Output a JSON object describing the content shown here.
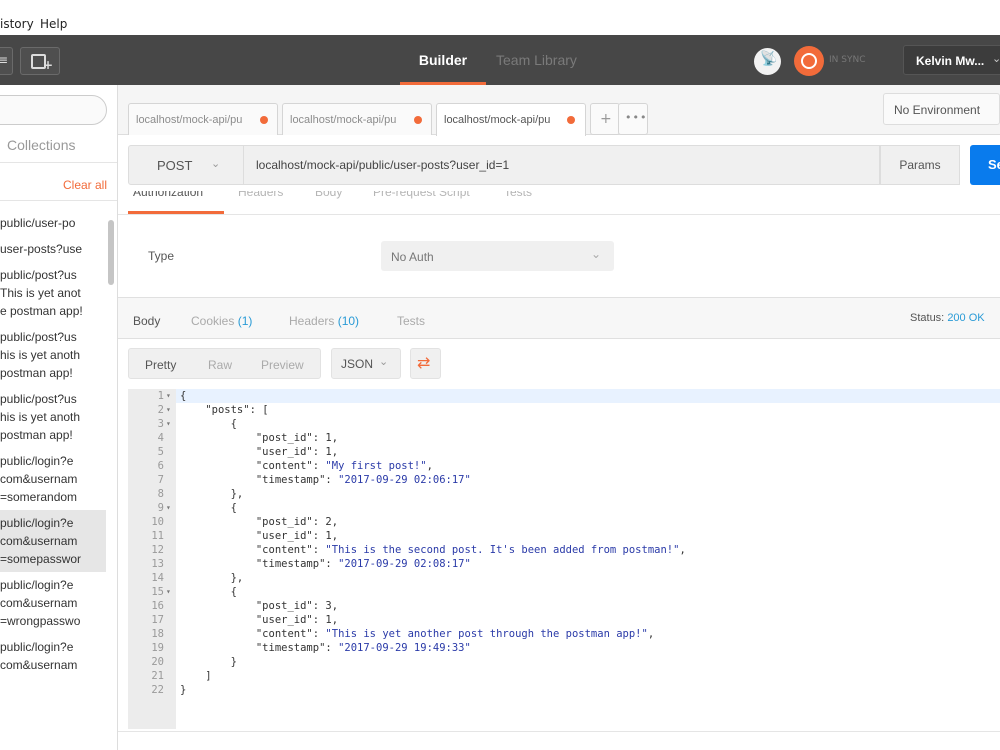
{
  "menubar": {
    "items": [
      {
        "label": "istory"
      },
      {
        "label": "Help"
      }
    ]
  },
  "header": {
    "builder_tab": "Builder",
    "team_tab": "Team Library",
    "sync_status": "IN SYNC",
    "user_name": "Kelvin Mw...",
    "accent_color": "#f26b3a"
  },
  "sidebar": {
    "collections_tab": "Collections",
    "clear_all": "Clear all",
    "history": [
      {
        "lines": [
          "public/user-po"
        ]
      },
      {
        "lines": [
          "user-posts?use"
        ]
      },
      {
        "lines": [
          "public/post?us",
          "This is yet anot",
          "e postman app!"
        ]
      },
      {
        "lines": [
          "public/post?us",
          "his is yet anoth",
          "postman app!"
        ]
      },
      {
        "lines": [
          "public/post?us",
          "his is yet anoth",
          "postman app!"
        ]
      },
      {
        "lines": [
          "public/login?e",
          "com&usernam",
          "=somerandom"
        ]
      },
      {
        "lines": [
          "public/login?e",
          "com&usernam",
          "=somepasswor"
        ],
        "active": true
      },
      {
        "lines": [
          "public/login?e",
          "com&usernam",
          "=wrongpasswo"
        ]
      },
      {
        "lines": [
          "public/login?e",
          "com&usernam"
        ]
      }
    ]
  },
  "request_tabs": [
    {
      "label": "localhost/mock-api/pu"
    },
    {
      "label": "localhost/mock-api/pu"
    },
    {
      "label": "localhost/mock-api/pu"
    }
  ],
  "environment": "No Environment",
  "request": {
    "method": "POST",
    "url": "localhost/mock-api/public/user-posts?user_id=1",
    "params_label": "Params",
    "send_label": "Se"
  },
  "request_section_tabs": {
    "authorization": "Authorization",
    "headers": "Headers",
    "body": "Body",
    "prerequest": "Pre-request Script",
    "tests": "Tests"
  },
  "auth": {
    "type_label": "Type",
    "type_value": "No Auth"
  },
  "response": {
    "tabs": {
      "body": "Body",
      "cookies": "Cookies",
      "cookies_count": "(1)",
      "headers": "Headers",
      "headers_count": "(10)",
      "tests": "Tests"
    },
    "status_label": "Status:",
    "status_value": "200 OK",
    "view_modes": {
      "pretty": "Pretty",
      "raw": "Raw",
      "preview": "Preview"
    },
    "format": "JSON"
  },
  "code_lines": [
    {
      "n": "1",
      "fold": true,
      "text": "{"
    },
    {
      "n": "2",
      "fold": true,
      "text": "    \"posts\": ["
    },
    {
      "n": "3",
      "fold": true,
      "text": "        {"
    },
    {
      "n": "4",
      "text": "            \"post_id\": 1,"
    },
    {
      "n": "5",
      "text": "            \"user_id\": 1,"
    },
    {
      "n": "6",
      "text": "            \"content\": \"My first post!\","
    },
    {
      "n": "7",
      "text": "            \"timestamp\": \"2017-09-29 02:06:17\""
    },
    {
      "n": "8",
      "text": "        },"
    },
    {
      "n": "9",
      "fold": true,
      "text": "        {"
    },
    {
      "n": "10",
      "text": "            \"post_id\": 2,"
    },
    {
      "n": "11",
      "text": "            \"user_id\": 1,"
    },
    {
      "n": "12",
      "text": "            \"content\": \"This is the second post. It's been added from postman!\","
    },
    {
      "n": "13",
      "text": "            \"timestamp\": \"2017-09-29 02:08:17\""
    },
    {
      "n": "14",
      "text": "        },"
    },
    {
      "n": "15",
      "fold": true,
      "text": "        {"
    },
    {
      "n": "16",
      "text": "            \"post_id\": 3,"
    },
    {
      "n": "17",
      "text": "            \"user_id\": 1,"
    },
    {
      "n": "18",
      "text": "            \"content\": \"This is yet another post through the postman app!\","
    },
    {
      "n": "19",
      "text": "            \"timestamp\": \"2017-09-29 19:49:33\""
    },
    {
      "n": "20",
      "text": "        }"
    },
    {
      "n": "21",
      "text": "    ]"
    },
    {
      "n": "22",
      "text": "}"
    }
  ]
}
